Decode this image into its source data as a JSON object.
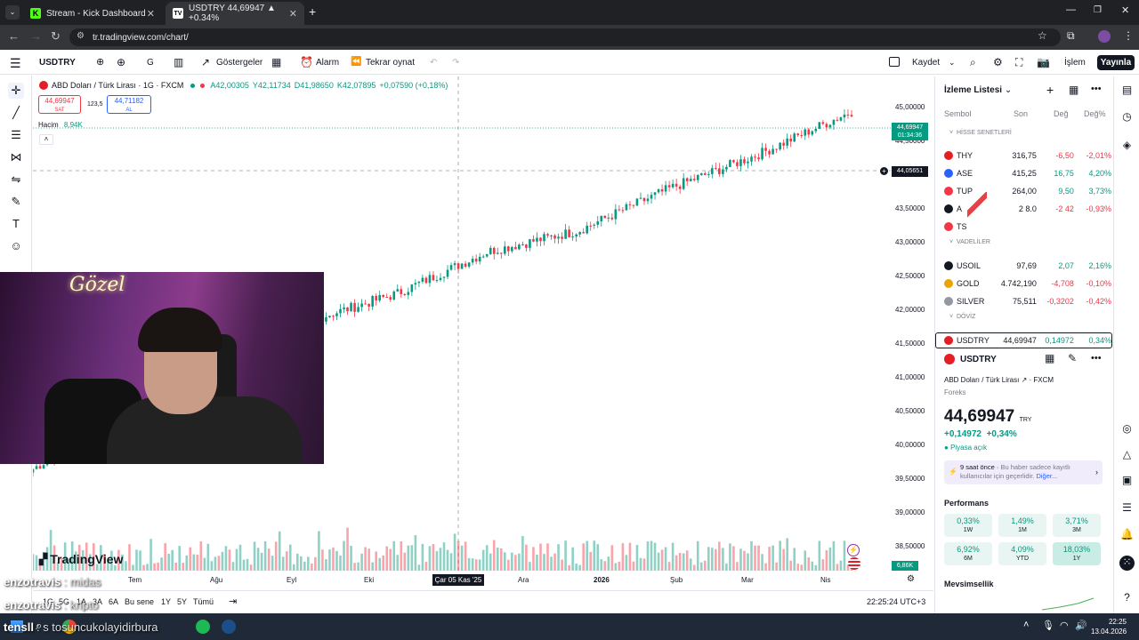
{
  "browser": {
    "tabs": [
      {
        "title": "Stream - Kick Dashboard"
      },
      {
        "title": "USDTRY 44,69947 ▲ +0.34%"
      }
    ],
    "url": "tr.tradingview.com/chart/"
  },
  "toolbar": {
    "symbol": "USDTRY",
    "interval": "G",
    "indicators": "Göstergeler",
    "alert": "Alarm",
    "replay": "Tekrar oynat",
    "save": "Kaydet",
    "trade": "İşlem",
    "publish": "Yayınla"
  },
  "chart": {
    "legend_title": "ABD Doları / Türk Lirası · 1G · FXCM",
    "ohlc": {
      "o": "A42,00305",
      "h": "Y42,11734",
      "l": "D41,98650",
      "c": "K42,07895",
      "chg": "+0,07590 (+0,18%)"
    },
    "sell_price": "44,69947",
    "sell_label": "SAT",
    "spread": "123,5",
    "buy_price": "44,71182",
    "buy_label": "AL",
    "volume_label": "Hacim",
    "volume_value": "8,94K",
    "last_price_tag": "44,69947",
    "countdown": "01:34:36",
    "crosshair_price": "44,05651",
    "volume_tag": "6,86K",
    "crosshair_date": "Çar 05 Kas '25",
    "watermark": "TradingView",
    "price_axis": [
      "45,00000",
      "44,50000",
      "43,50000",
      "43,00000",
      "42,50000",
      "42,00000",
      "41,50000",
      "41,00000",
      "40,50000",
      "40,00000",
      "39,50000",
      "39,00000",
      "38,50000"
    ],
    "time_axis": [
      "Tem",
      "Ağu",
      "Eyl",
      "Eki",
      "Ara",
      "2026",
      "Şub",
      "Mar",
      "Nis"
    ],
    "ranges": [
      "1G",
      "5G",
      "1A",
      "3A",
      "6A",
      "Bu sene",
      "1Y",
      "5Y",
      "Tümü"
    ],
    "clock": "22:25:24 UTC+3"
  },
  "chart_data": {
    "type": "candlestick",
    "x_labels": [
      "Tem",
      "Ağu",
      "Eyl",
      "Eki",
      "Kas",
      "Ara",
      "2026",
      "Şub",
      "Mar",
      "Nis"
    ],
    "close": [
      39.6,
      40.4,
      41.2,
      41.7,
      42.1,
      42.7,
      43.0,
      43.6,
      44.1,
      44.7
    ],
    "ylim": [
      38.2,
      45.3
    ],
    "ylabel": "",
    "volume_axis_label": "Hacim"
  },
  "watchlist": {
    "title": "İzleme Listesi",
    "columns": {
      "symbol": "Sembol",
      "last": "Son",
      "chg": "Değ",
      "pct": "Değ%"
    },
    "sections": [
      {
        "name": "HİSSE SENETLERİ",
        "rows": [
          {
            "sym": "THY",
            "last": "316,75",
            "chg": "-6,50",
            "pct": "-2,01%",
            "dir": "dn",
            "color": "#e31e24"
          },
          {
            "sym": "ASE",
            "last": "415,25",
            "chg": "16,75",
            "pct": "4,20%",
            "dir": "up",
            "color": "#2962ff"
          },
          {
            "sym": "TUP",
            "last": "264,00",
            "chg": "9,50",
            "pct": "3,73%",
            "dir": "up",
            "color": "#f23645"
          },
          {
            "sym": "A",
            "last": "2 8.0",
            "chg": "-2 42",
            "pct": "-0,93%",
            "dir": "dn",
            "color": "#131722"
          },
          {
            "sym": "TS",
            "last": "",
            "chg": "",
            "pct": "",
            "dir": "dn",
            "color": "#f23645"
          }
        ]
      },
      {
        "name": "VADELİLER",
        "rows": [
          {
            "sym": "USOIL",
            "last": "97,69",
            "chg": "2,07",
            "pct": "2,16%",
            "dir": "up",
            "color": "#131722"
          },
          {
            "sym": "GOLD",
            "last": "4.742,190",
            "chg": "-4,708",
            "pct": "-0,10%",
            "dir": "dn",
            "color": "#e8a500"
          },
          {
            "sym": "SILVER",
            "last": "75,511",
            "chg": "-0,3202",
            "pct": "-0,42%",
            "dir": "dn",
            "color": "#9598a1"
          }
        ]
      },
      {
        "name": "DÖVİZ",
        "rows": [
          {
            "sym": "USDTRY",
            "last": "44,69947",
            "chg": "0,14972",
            "pct": "0,34%",
            "dir": "up",
            "color": "#e31e24"
          }
        ]
      }
    ]
  },
  "details": {
    "symbol": "USDTRY",
    "name": "ABD Doları / Türk Lirası",
    "exchange": "FXCM",
    "type": "Foreks",
    "price": "44,69947",
    "currency": "TRY",
    "change": "+0,14972",
    "change_pct": "+0,34%",
    "status": "Piyasa açık",
    "news_time": "9 saat önce",
    "news_text": "Bu haber sadece kayıtlı kullanıcılar için geçerlidir.",
    "news_more": "Diğer...",
    "performance_title": "Performans",
    "performance": [
      {
        "value": "0,33%",
        "label": "1W",
        "color": "#e8f5f2"
      },
      {
        "value": "1,49%",
        "label": "1M",
        "color": "#e8f5f2"
      },
      {
        "value": "3,71%",
        "label": "3M",
        "color": "#e8f5f2"
      },
      {
        "value": "6,92%",
        "label": "6M",
        "color": "#e8f5f2"
      },
      {
        "value": "4,09%",
        "label": "YTD",
        "color": "#e8f5f2"
      },
      {
        "value": "18,03%",
        "label": "1Y",
        "color": "#c9ece4"
      }
    ],
    "seasonality": "Mevsimsellik"
  },
  "stream_chat": [
    {
      "user": "enzotravis",
      "msg": ": midas"
    },
    {
      "user": "enzotravis",
      "msg": ": kripto"
    },
    {
      "user": "tensll",
      "msg": ": s tosuncukolayidirbura"
    }
  ],
  "webcam": {
    "neon_text": "Gözel"
  },
  "taskbar": {
    "time": "22:25",
    "date": "13.04.2026"
  }
}
